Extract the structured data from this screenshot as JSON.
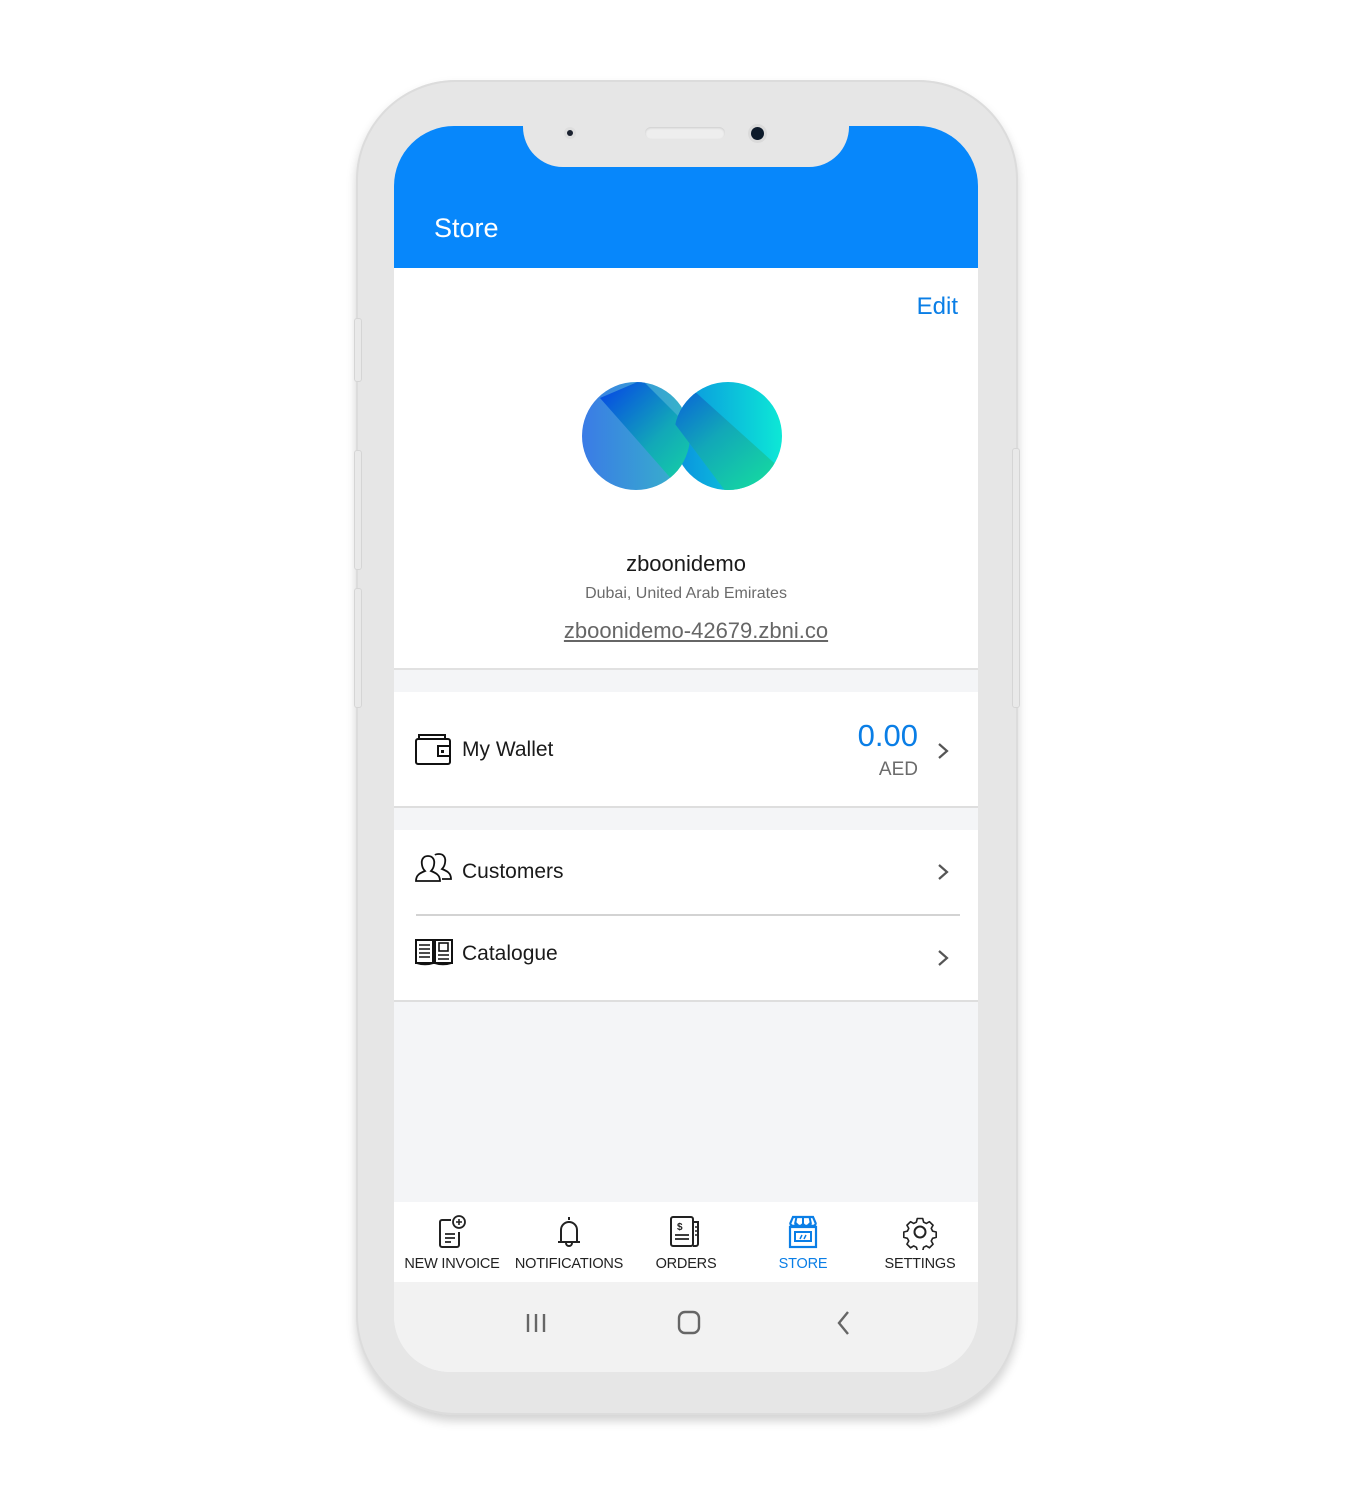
{
  "app": {
    "title": "Store",
    "accent_color": "#0787fb"
  },
  "profile": {
    "edit_label": "Edit",
    "store_name": "zboonidemo",
    "location": "Dubai, United Arab Emirates",
    "url": "zboonidemo-42679.zbni.co",
    "logo_icon": "infinity-logo-icon"
  },
  "wallet": {
    "label": "My Wallet",
    "amount": "0.00",
    "currency": "AED",
    "icon": "wallet-icon"
  },
  "menu": {
    "items": [
      {
        "label": "Customers",
        "icon": "customers-icon"
      },
      {
        "label": "Catalogue",
        "icon": "catalogue-icon"
      }
    ]
  },
  "tabbar": {
    "items": [
      {
        "label": "NEW INVOICE",
        "icon": "new-invoice-icon",
        "active": false
      },
      {
        "label": "NOTIFICATIONS",
        "icon": "bell-icon",
        "active": false
      },
      {
        "label": "ORDERS",
        "icon": "orders-icon",
        "active": false
      },
      {
        "label": "STORE",
        "icon": "store-icon",
        "active": true
      },
      {
        "label": "SETTINGS",
        "icon": "gear-icon",
        "active": false
      }
    ]
  },
  "system_nav": {
    "buttons": [
      "recent-apps",
      "home",
      "back"
    ]
  }
}
